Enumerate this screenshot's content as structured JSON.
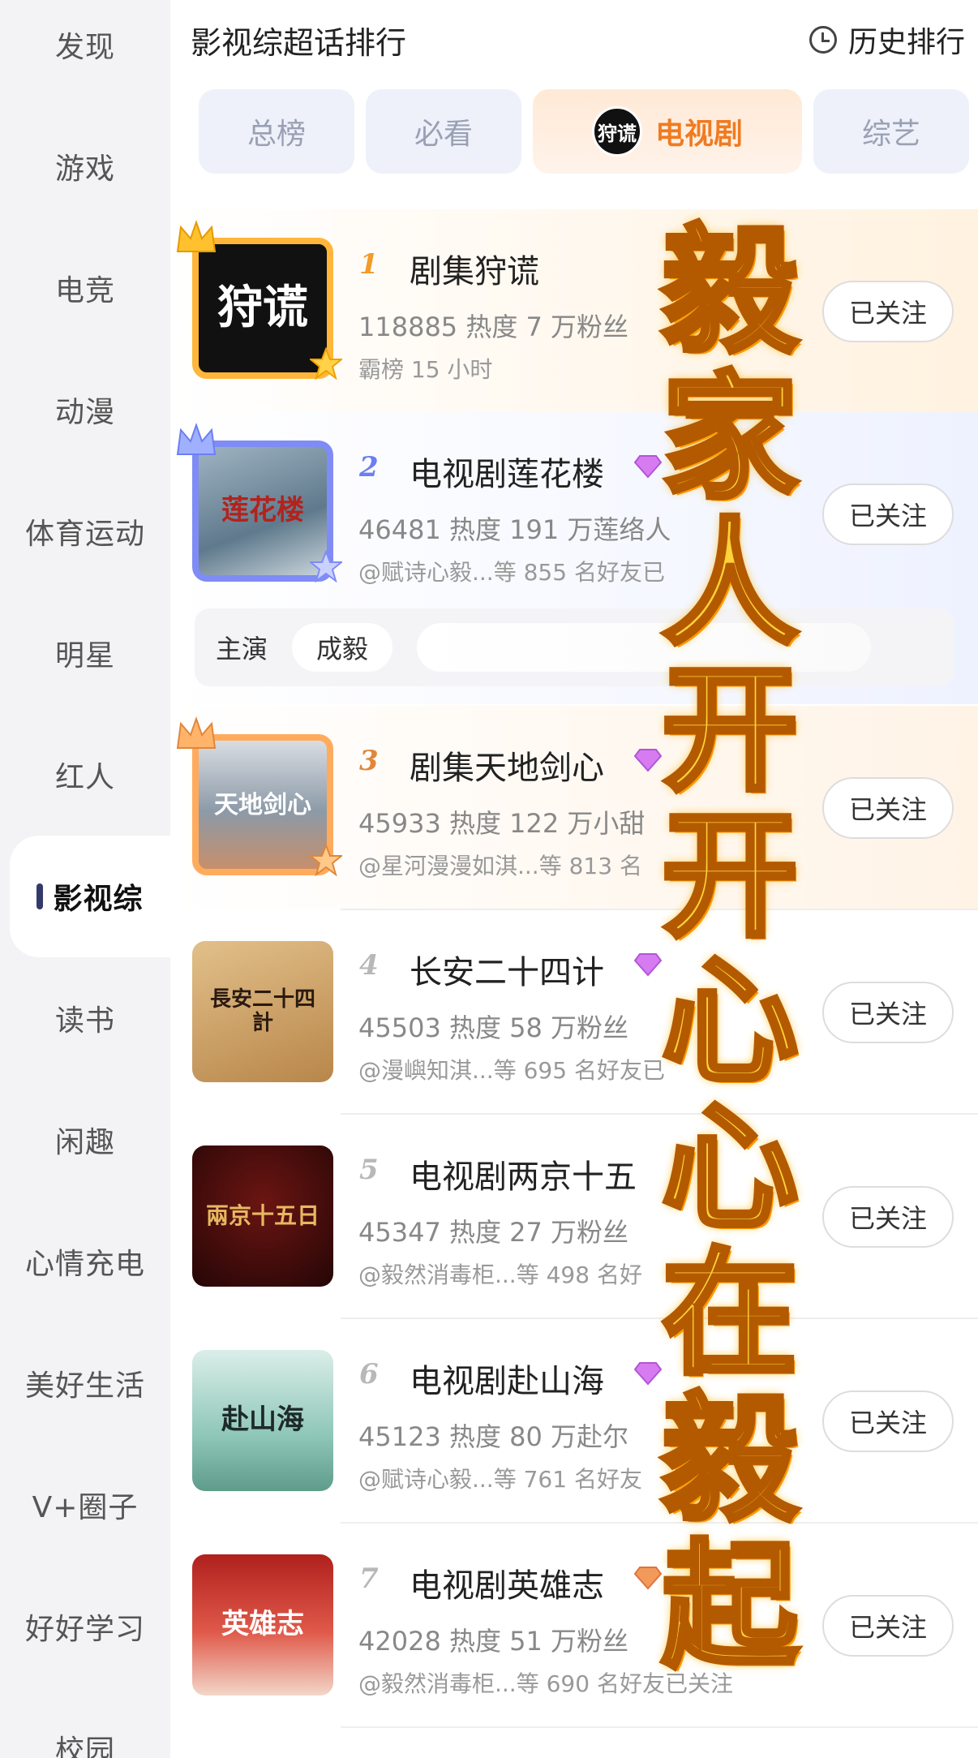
{
  "sidebar": {
    "items": [
      {
        "label": "发现"
      },
      {
        "label": "游戏"
      },
      {
        "label": "电竞"
      },
      {
        "label": "动漫"
      },
      {
        "label": "体育运动"
      },
      {
        "label": "明星"
      },
      {
        "label": "红人"
      },
      {
        "label": "影视综",
        "active": true
      },
      {
        "label": "读书"
      },
      {
        "label": "闲趣"
      },
      {
        "label": "心情充电"
      },
      {
        "label": "美好生活"
      },
      {
        "label": "V+圈子"
      },
      {
        "label": "好好学习"
      },
      {
        "label": "校园"
      }
    ]
  },
  "header": {
    "title": "影视综超话排行",
    "history_label": "历史排行"
  },
  "tabs": [
    {
      "label": "总榜"
    },
    {
      "label": "必看"
    },
    {
      "label": "电视剧",
      "logo_text": "狩谎",
      "active": true
    },
    {
      "label": "综艺"
    }
  ],
  "colors": {
    "accent": "#f07b21",
    "rank1": "#f29b2c",
    "rank2": "#6c7ff0",
    "rank3": "#e0873a",
    "rank_other": "#b8b8b8"
  },
  "rankings": [
    {
      "rank": "1",
      "name": "剧集狩谎",
      "stats": "118885 热度 7 万粉丝",
      "sub": "霸榜 15 小时",
      "poster_text": "狩谎",
      "follow_label": "已关注"
    },
    {
      "rank": "2",
      "name": "电视剧莲花楼",
      "stats": "46481 热度 191 万莲络人",
      "sub": "@赋诗心毅...等 855 名好友已",
      "poster_text": "莲花楼",
      "follow_label": "已关注",
      "cast": {
        "label": "主演",
        "member": "成毅"
      }
    },
    {
      "rank": "3",
      "name": "剧集天地剑心",
      "stats": "45933 热度 122 万小甜",
      "sub": "@星河漫漫如淇...等 813 名",
      "poster_text": "天地剑心",
      "follow_label": "已关注"
    },
    {
      "rank": "4",
      "name": "长安二十四计",
      "stats": "45503 热度 58 万粉丝",
      "sub": "@漫嶼知淇...等 695 名好友已",
      "poster_text": "長安二十四計",
      "follow_label": "已关注"
    },
    {
      "rank": "5",
      "name": "电视剧两京十五",
      "stats": "45347 热度 27 万粉丝",
      "sub": "@毅然消毒柜...等 498 名好",
      "poster_text": "兩京十五日",
      "follow_label": "已关注"
    },
    {
      "rank": "6",
      "name": "电视剧赴山海",
      "stats": "45123 热度 80 万赴尔",
      "sub": "@赋诗心毅...等 761 名好友",
      "poster_text": "赴山海",
      "follow_label": "已关注"
    },
    {
      "rank": "7",
      "name": "电视剧英雄志",
      "stats": "42028 热度 51 万粉丝",
      "sub": "@毅然消毒柜...等 690 名好友已关注",
      "poster_text": "英雄志",
      "follow_label": "已关注"
    }
  ],
  "overlay_caption": [
    "毅",
    "家",
    "人",
    "开",
    "开",
    "心",
    "心",
    "在",
    "毅",
    "起"
  ]
}
